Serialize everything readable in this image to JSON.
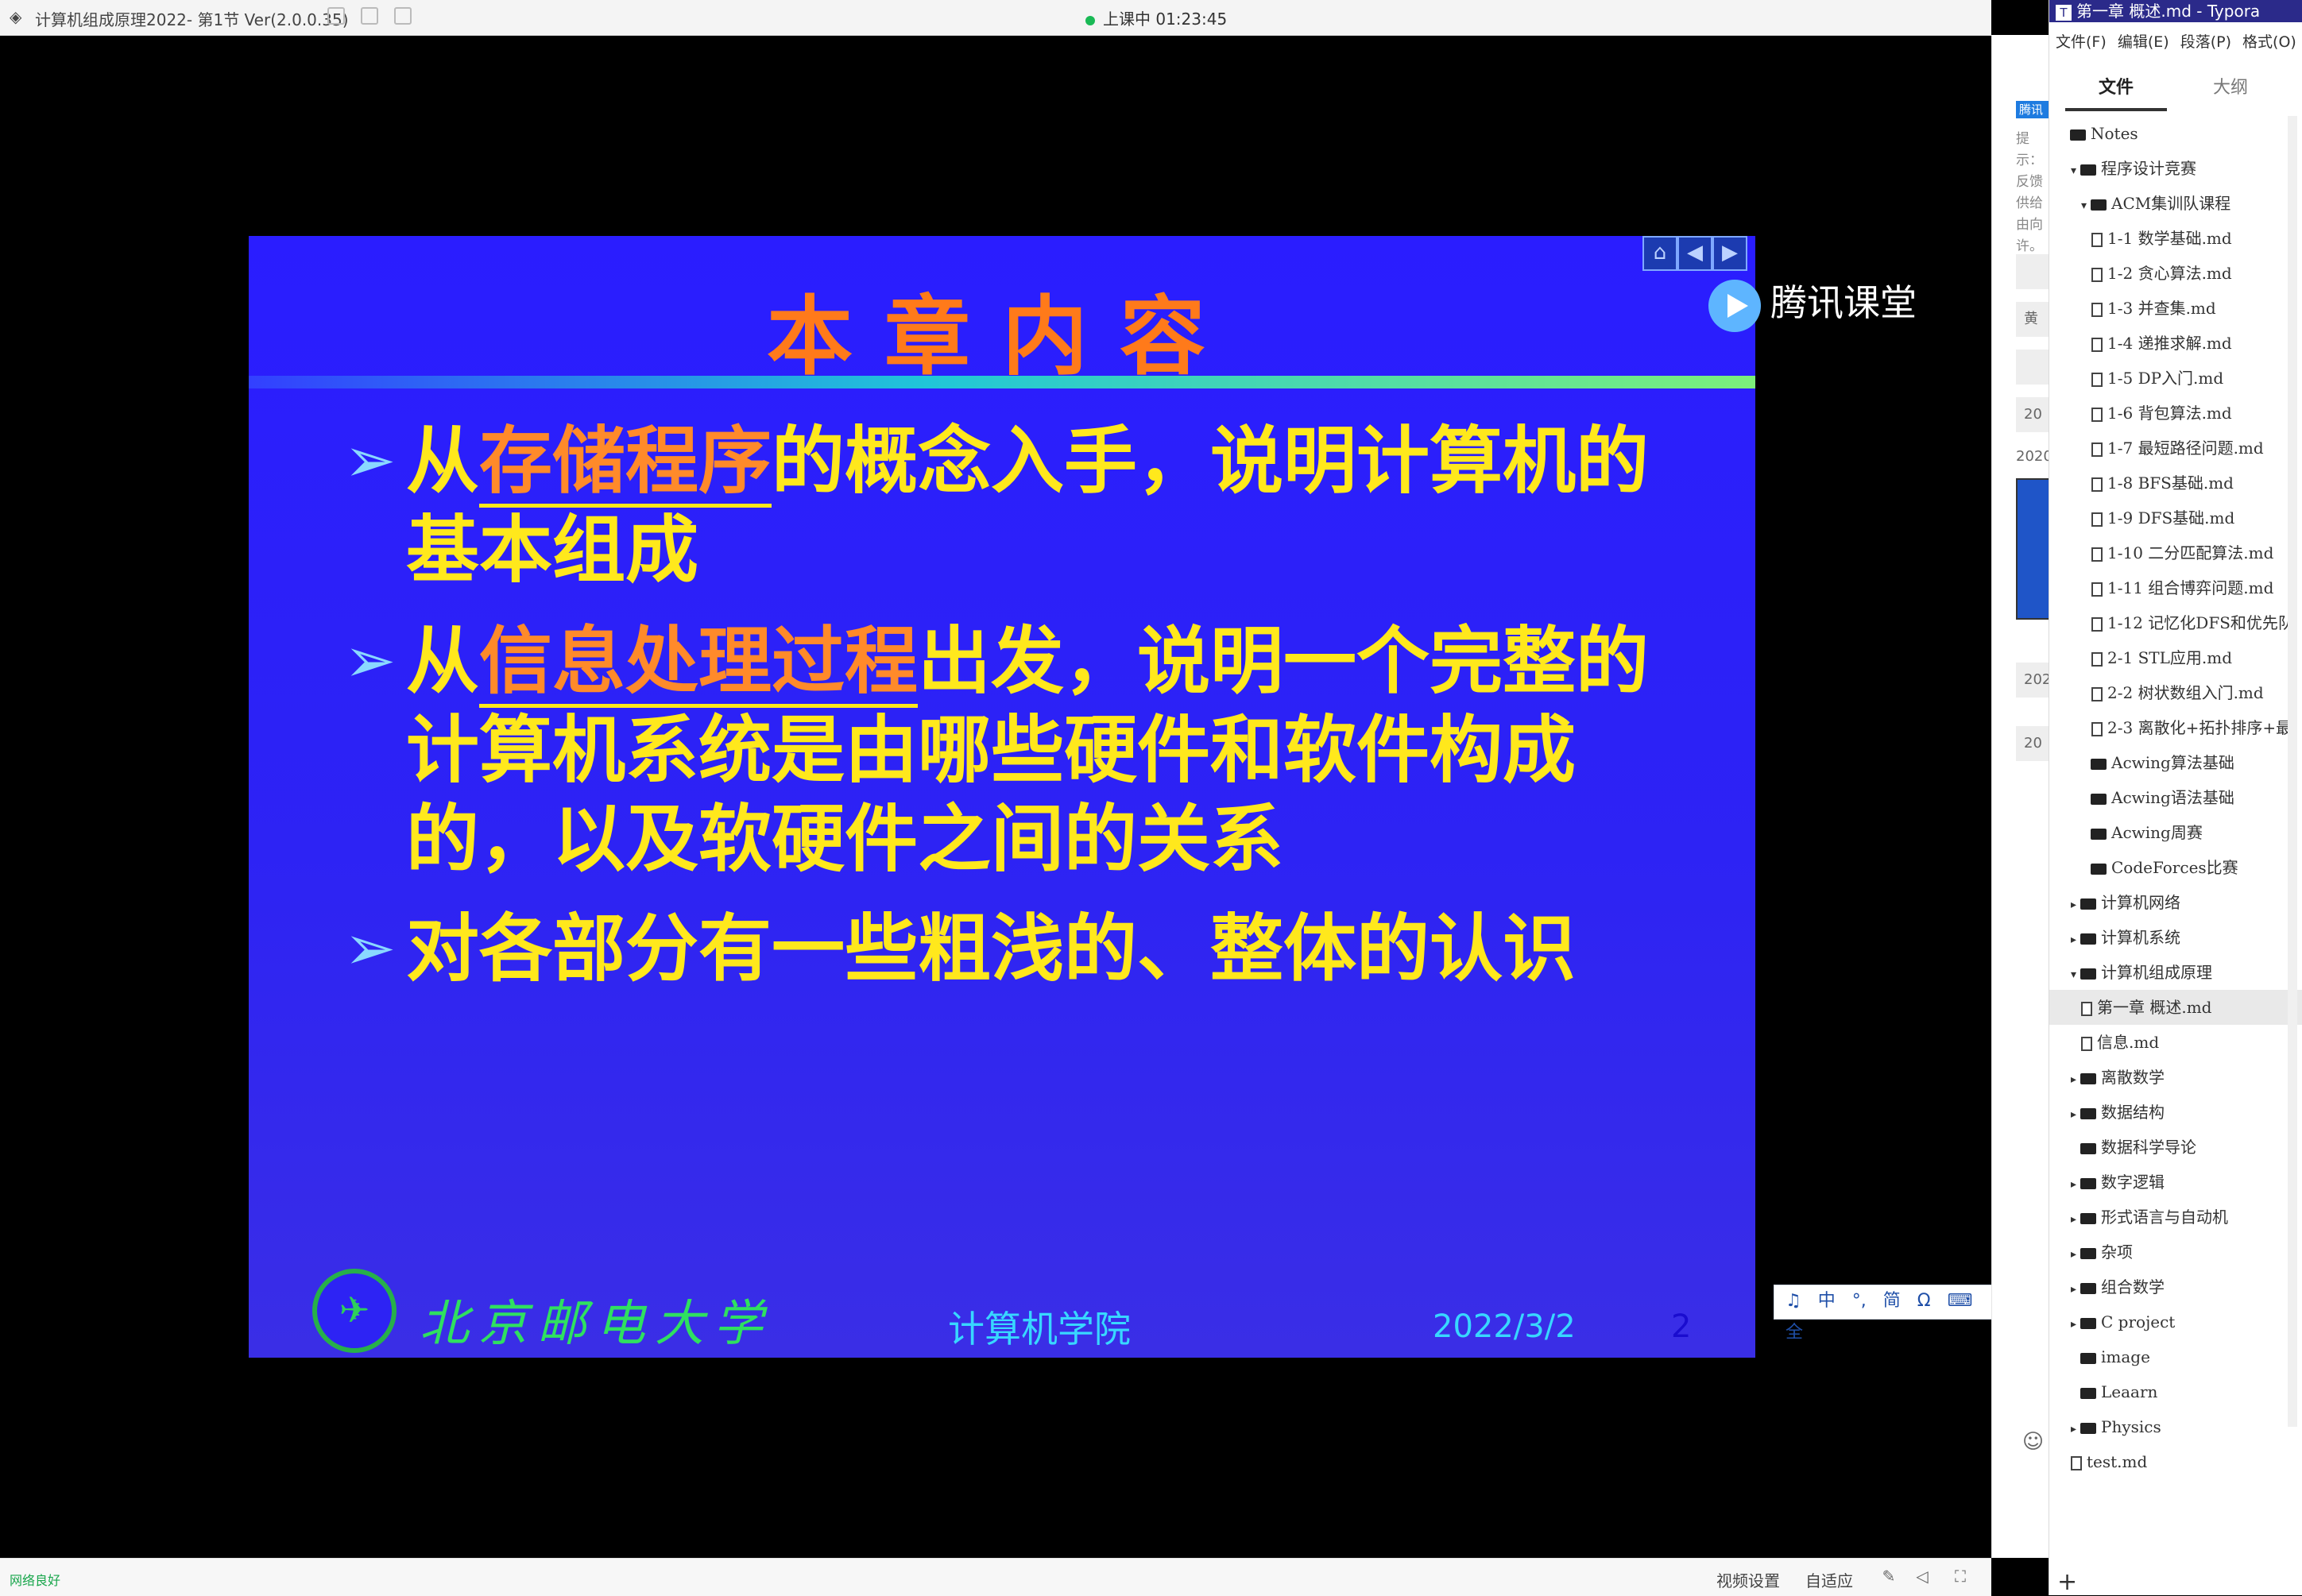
{
  "classroom": {
    "window_title": "计算机组成原理2022- 第1节 Ver(2.0.0.35)",
    "live_status": "上课中 01:23:45",
    "network_status": "网络良好",
    "bottom_buttons": {
      "video_settings": "视频设置",
      "auto_fit": "自适应"
    },
    "watermark": "腾讯课堂",
    "side_panel": {
      "tag": "腾讯",
      "hint": "提示：反馈供给由向许。",
      "rows": [
        "黄",
        "20",
        "2020",
        "202",
        "20"
      ]
    }
  },
  "slide": {
    "title": "本章内容",
    "bullets": [
      {
        "pre": "从",
        "highlight": "存储程序",
        "post": "的概念入手，说明计算机的基本组成"
      },
      {
        "pre": "从",
        "highlight": "信息处理过程",
        "post": "出发，说明一个完整的计算机系统是由哪些硬件和软件构成的，以及软硬件之间的关系"
      },
      {
        "pre": "",
        "highlight": "",
        "post": "对各部分有一些粗浅的、整体的认识"
      }
    ],
    "footer": {
      "university": "北京邮电大学",
      "school": "计算机学院",
      "date": "2022/3/2",
      "page": "2"
    }
  },
  "ime": {
    "items": [
      "中",
      "°,",
      "简",
      "Ω",
      "⌨",
      "全"
    ]
  },
  "typora": {
    "window_title": "第一章 概述.md - Typora",
    "menu": [
      "文件(F)",
      "编辑(E)",
      "段落(P)",
      "格式(O)"
    ],
    "tabs": {
      "files": "文件",
      "outline": "大纲"
    },
    "tree": [
      {
        "label": "Notes",
        "type": "folder",
        "level": 0,
        "caret": ""
      },
      {
        "label": "程序设计竞赛",
        "type": "folder",
        "level": 1,
        "caret": "▾"
      },
      {
        "label": "ACM集训队课程",
        "type": "folder",
        "level": 2,
        "caret": "▾"
      },
      {
        "label": "1-1 数学基础.md",
        "type": "file",
        "level": 3
      },
      {
        "label": "1-2 贪心算法.md",
        "type": "file",
        "level": 3
      },
      {
        "label": "1-3 并查集.md",
        "type": "file",
        "level": 3
      },
      {
        "label": "1-4 递推求解.md",
        "type": "file",
        "level": 3
      },
      {
        "label": "1-5 DP入门.md",
        "type": "file",
        "level": 3
      },
      {
        "label": "1-6 背包算法.md",
        "type": "file",
        "level": 3
      },
      {
        "label": "1-7 最短路径问题.md",
        "type": "file",
        "level": 3
      },
      {
        "label": "1-8 BFS基础.md",
        "type": "file",
        "level": 3
      },
      {
        "label": "1-9 DFS基础.md",
        "type": "file",
        "level": 3
      },
      {
        "label": "1-10 二分匹配算法.md",
        "type": "file",
        "level": 3
      },
      {
        "label": "1-11 组合博弈问题.md",
        "type": "file",
        "level": 3
      },
      {
        "label": "1-12 记忆化DFS和优先队",
        "type": "file",
        "level": 3
      },
      {
        "label": "2-1 STL应用.md",
        "type": "file",
        "level": 3
      },
      {
        "label": "2-2 树状数组入门.md",
        "type": "file",
        "level": 3
      },
      {
        "label": "2-3 离散化+拓扑排序+最",
        "type": "file",
        "level": 3
      },
      {
        "label": "Acwing算法基础",
        "type": "folder",
        "level": 2,
        "caret": ""
      },
      {
        "label": "Acwing语法基础",
        "type": "folder",
        "level": 2,
        "caret": ""
      },
      {
        "label": "Acwing周赛",
        "type": "folder",
        "level": 2,
        "caret": ""
      },
      {
        "label": "CodeForces比赛",
        "type": "folder",
        "level": 2,
        "caret": ""
      },
      {
        "label": "计算机网络",
        "type": "folder",
        "level": 1,
        "caret": "▸"
      },
      {
        "label": "计算机系统",
        "type": "folder",
        "level": 1,
        "caret": "▸"
      },
      {
        "label": "计算机组成原理",
        "type": "folder",
        "level": 1,
        "caret": "▾"
      },
      {
        "label": "第一章 概述.md",
        "type": "file",
        "level": 2,
        "active": true
      },
      {
        "label": "信息.md",
        "type": "file",
        "level": 2
      },
      {
        "label": "离散数学",
        "type": "folder",
        "level": 1,
        "caret": "▸"
      },
      {
        "label": "数据结构",
        "type": "folder",
        "level": 1,
        "caret": "▸"
      },
      {
        "label": "数据科学导论",
        "type": "folder",
        "level": 1,
        "caret": ""
      },
      {
        "label": "数字逻辑",
        "type": "folder",
        "level": 1,
        "caret": "▸"
      },
      {
        "label": "形式语言与自动机",
        "type": "folder",
        "level": 1,
        "caret": "▸"
      },
      {
        "label": "杂项",
        "type": "folder",
        "level": 1,
        "caret": "▸"
      },
      {
        "label": "组合数学",
        "type": "folder",
        "level": 1,
        "caret": "▸"
      },
      {
        "label": "C project",
        "type": "folder",
        "level": 1,
        "caret": "▸"
      },
      {
        "label": "image",
        "type": "folder",
        "level": 1,
        "caret": ""
      },
      {
        "label": "Leaarn",
        "type": "folder",
        "level": 1,
        "caret": ""
      },
      {
        "label": "Physics",
        "type": "folder",
        "level": 1,
        "caret": "▸"
      },
      {
        "label": "test.md",
        "type": "file",
        "level": 1
      }
    ],
    "add_button": "+"
  }
}
